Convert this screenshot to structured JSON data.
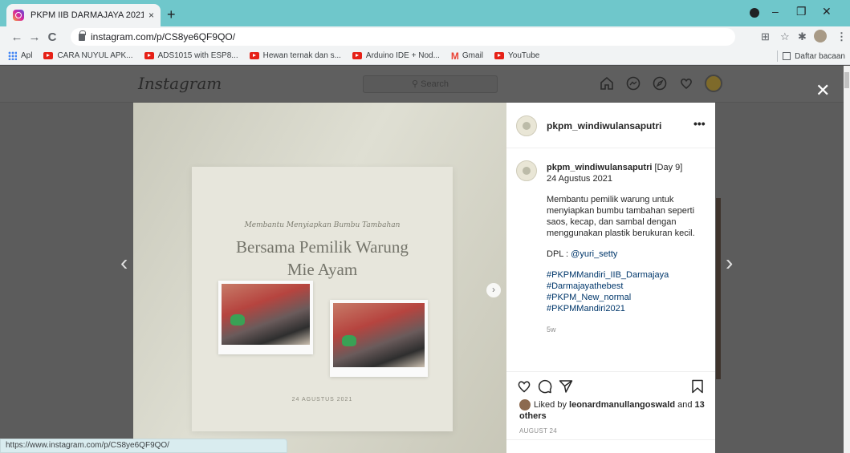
{
  "browser": {
    "tab_title": "PKPM IIB DARMAJAYA 2021 (@p",
    "tab_close": "×",
    "new_tab": "+",
    "url": "instagram.com/p/CS8ye6QF9QO/",
    "back": "←",
    "forward": "→",
    "reload": "C",
    "window_minimize": "–",
    "window_restore": "❐",
    "window_close": "✕",
    "translate_icon": "⊞",
    "star_icon": "☆",
    "extensions_icon": "✱",
    "menu_icon": "⋮",
    "bookmarks": [
      {
        "label": "Apl",
        "icon": "apps-grid-icon"
      },
      {
        "label": "CARA NUYUL APK...",
        "icon": "youtube-icon"
      },
      {
        "label": "ADS1015 with ESP8...",
        "icon": "youtube-icon"
      },
      {
        "label": "Hewan ternak dan s...",
        "icon": "youtube-icon"
      },
      {
        "label": "Arduino IDE + Nod...",
        "icon": "youtube-icon"
      },
      {
        "label": "Gmail",
        "icon": "gmail-icon"
      },
      {
        "label": "YouTube",
        "icon": "youtube-icon"
      }
    ],
    "reading_list": "Daftar bacaan",
    "status_url": "https://www.instagram.com/p/CS8ye6QF9QO/"
  },
  "instagram": {
    "logo": "Instagram",
    "search_placeholder": "Search",
    "close": "✕",
    "prev_arrow": "‹",
    "next_arrow": "›"
  },
  "post_image": {
    "subtitle": "Membantu Menyiapkan Bumbu Tambahan",
    "title_line1": "Bersama Pemilik Warung",
    "title_line2": "Mie Ayam",
    "date": "24 AGUSTUS 2021",
    "next_slide": "›"
  },
  "panel": {
    "username": "pkpm_windiwulansaputri",
    "more": "•••",
    "caption_user": "pkpm_windiwulansaputri",
    "caption_day": " [Day 9]",
    "caption_date": "24 Agustus 2021",
    "caption_body": "Membantu pemilik warung untuk menyiapkan bumbu tambahan seperti saos, kecap, dan sambal dengan menggunakan plastik berukuran kecil.",
    "dpl_label": "DPL : ",
    "dpl_mention": "@yuri_setty",
    "hashtags": [
      "#PKPMMandiri_IIB_Darmajaya",
      "#Darmajayathebest",
      "#PKPM_New_normal",
      "#PKPMMandiri2021"
    ],
    "time_ago": "5w",
    "liked_by_prefix": "Liked by ",
    "liked_by_user": "leonardmanullangoswald",
    "liked_by_and": " and ",
    "liked_by_others": "13 others",
    "post_date": "AUGUST 24"
  },
  "icons": {
    "header": [
      "home-icon",
      "messenger-icon",
      "explore-icon",
      "heart-icon",
      "profile-avatar"
    ],
    "actions": [
      "like-icon",
      "comment-icon",
      "share-icon",
      "save-icon"
    ]
  }
}
